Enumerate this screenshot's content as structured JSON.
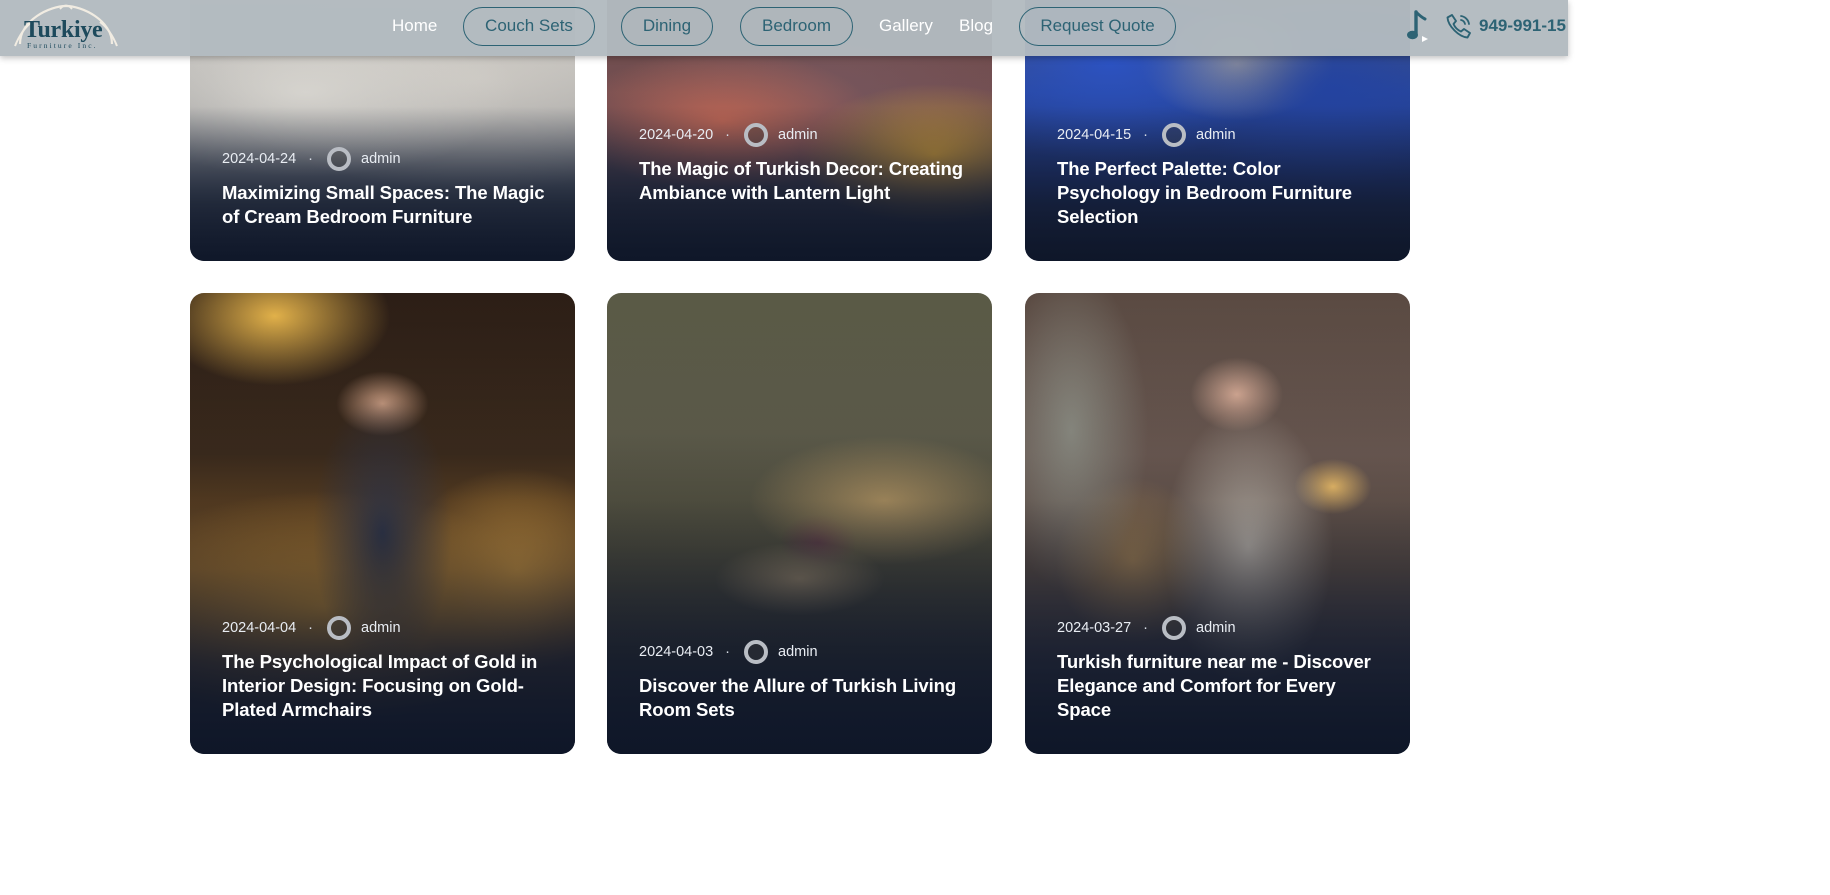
{
  "header": {
    "logo": {
      "word": "Turkiye",
      "subtitle": "Furniture Inc."
    },
    "nav": {
      "home": "Home",
      "couch_sets": "Couch Sets",
      "dining": "Dining",
      "bedroom": "Bedroom",
      "gallery": "Gallery",
      "blog": "Blog",
      "request_quote": "Request Quote"
    },
    "music_icon": "music-note-icon",
    "phone_icon": "phone-icon",
    "phone_number": "949-991-15"
  },
  "posts": [
    {
      "date": "2024-04-24",
      "separator": "·",
      "author": "admin",
      "title": "Maximizing Small Spaces: The Magic of Cream Bedroom Furniture"
    },
    {
      "date": "2024-04-20",
      "separator": "·",
      "author": "admin",
      "title": "The Magic of Turkish Decor: Creating Ambiance with Lantern Light"
    },
    {
      "date": "2024-04-15",
      "separator": "·",
      "author": "admin",
      "title": "The Perfect Palette: Color Psychology in Bedroom Furniture Selection"
    },
    {
      "date": "2024-04-04",
      "separator": "·",
      "author": "admin",
      "title": "The Psychological Impact of Gold in Interior Design: Focusing on Gold-Plated Armchairs"
    },
    {
      "date": "2024-04-03",
      "separator": "·",
      "author": "admin",
      "title": "Discover the Allure of Turkish Living Room Sets"
    },
    {
      "date": "2024-03-27",
      "separator": "·",
      "author": "admin",
      "title": "Turkish furniture near me - Discover Elegance and Comfort for Every Space"
    }
  ],
  "colors": {
    "header_bg": "#b2bac0",
    "brand_teal": "#2d6374",
    "card_text": "#ffffff"
  }
}
